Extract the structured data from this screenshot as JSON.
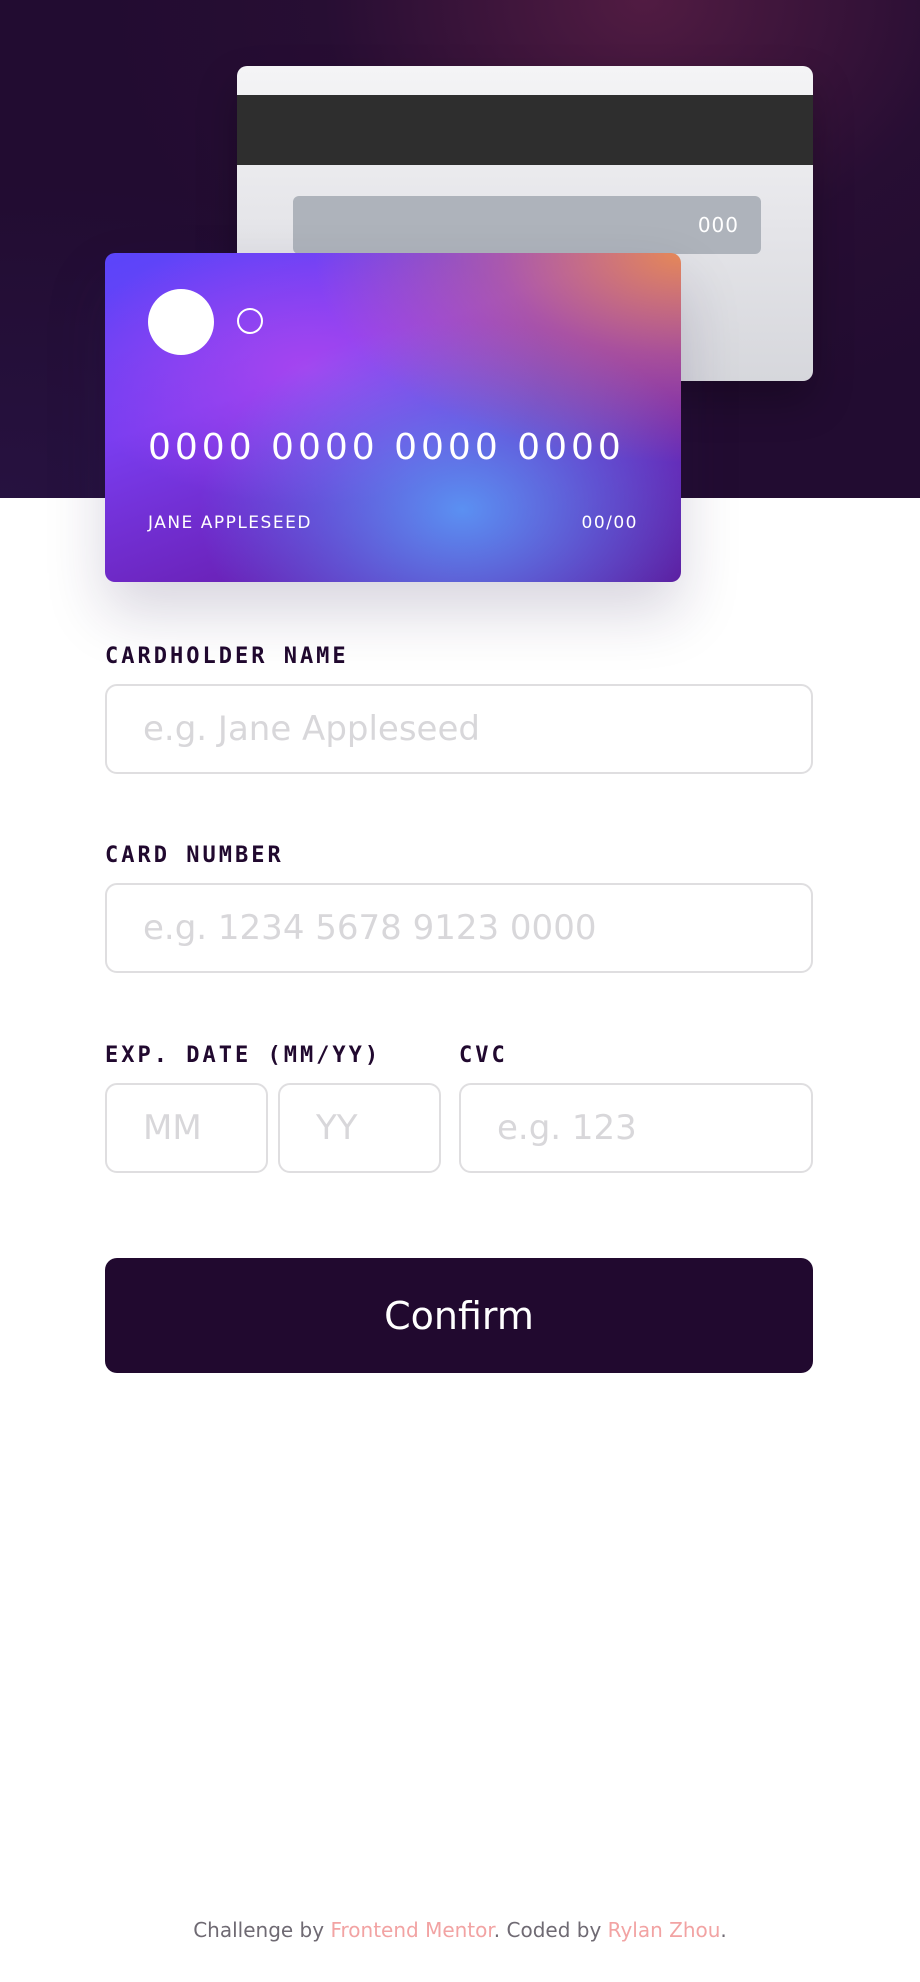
{
  "card_back": {
    "cvc": "000"
  },
  "card_front": {
    "number": "0000 0000 0000 0000",
    "holder": "JANE APPLESEED",
    "expiry": "00/00"
  },
  "form": {
    "name_label": "CARDHOLDER NAME",
    "name_placeholder": "e.g. Jane Appleseed",
    "number_label": "CARD NUMBER",
    "number_placeholder": "e.g. 1234 5678 9123 0000",
    "exp_label": "EXP. DATE (MM/YY)",
    "mm_placeholder": "MM",
    "yy_placeholder": "YY",
    "cvc_label": "CVC",
    "cvc_placeholder": "e.g. 123",
    "confirm_label": "Confirm"
  },
  "footer": {
    "prefix": "Challenge by ",
    "mentor_link": "Frontend Mentor",
    "middle": ". Coded by ",
    "author_link": "Rylan Zhou",
    "suffix": "."
  }
}
